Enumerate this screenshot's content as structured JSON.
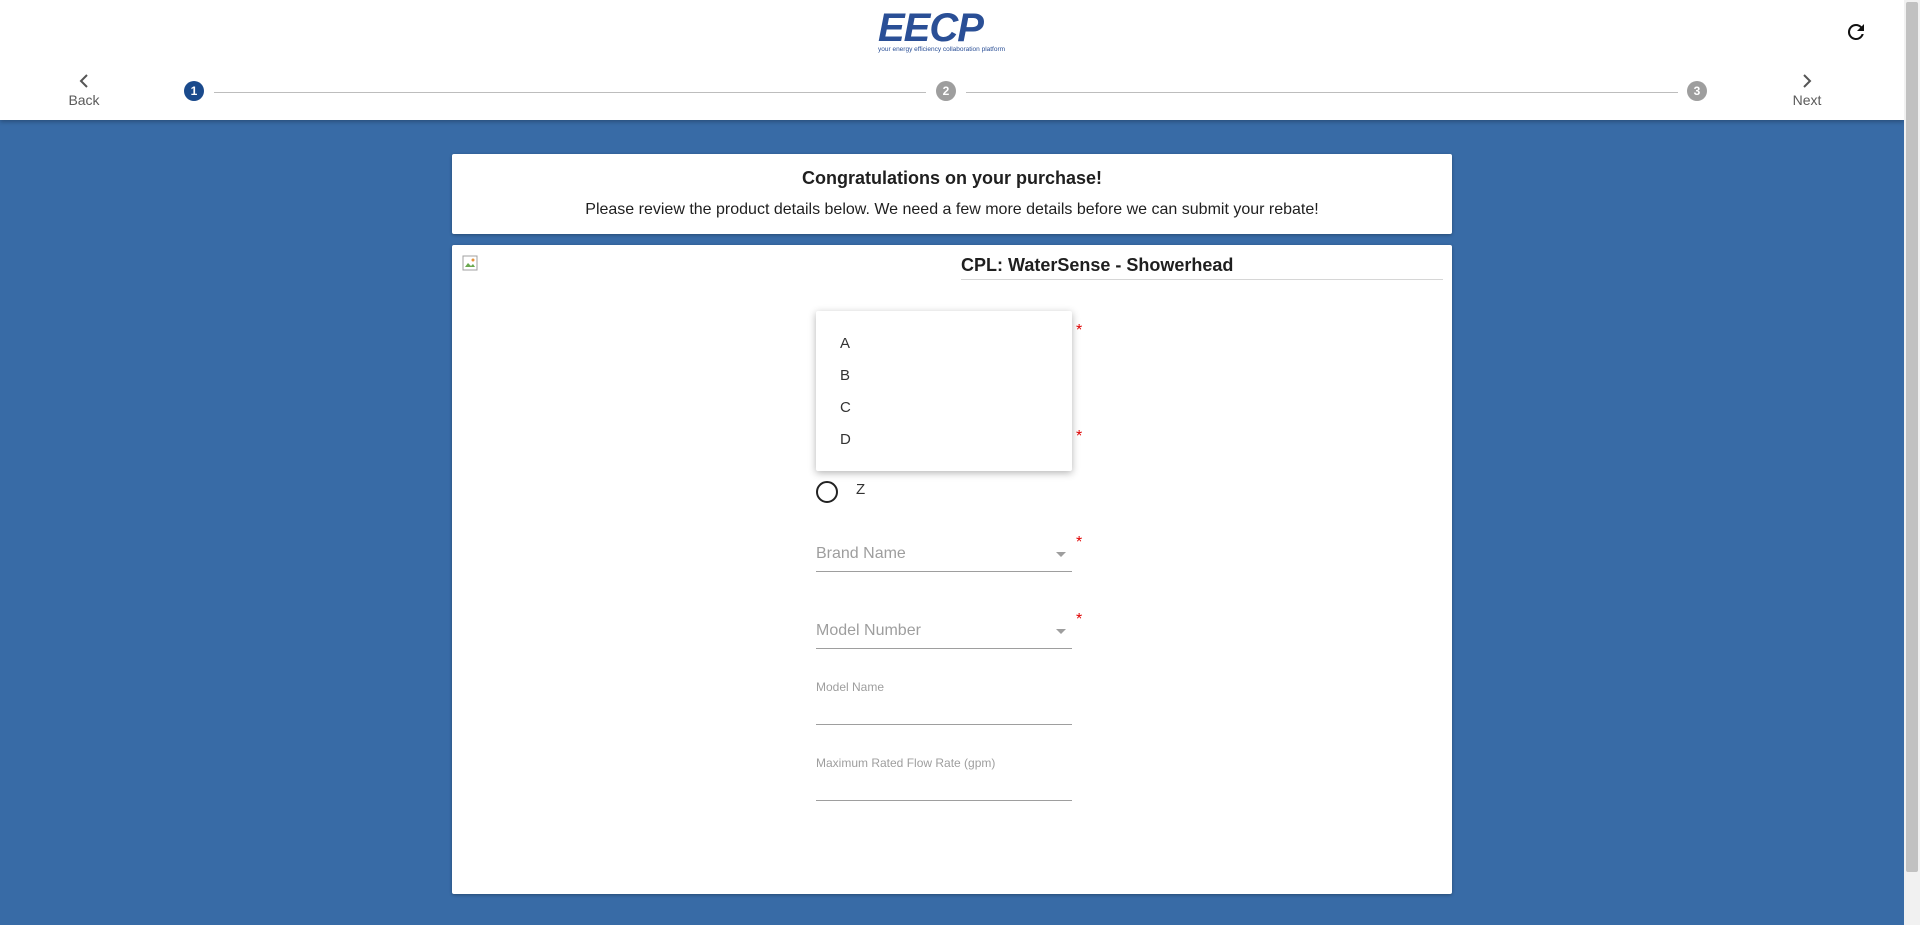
{
  "header": {
    "logo_text": "EECP",
    "logo_tagline": "your energy efficiency collaboration platform",
    "back_label": "Back",
    "next_label": "Next",
    "steps": [
      "1",
      "2",
      "3"
    ],
    "active_step": 1
  },
  "intro": {
    "title": "Congratulations on your purchase!",
    "subtitle": "Please review the product details below. We need a few more details before we can submit your rebate!"
  },
  "product": {
    "title": "CPL: WaterSense - Showerhead"
  },
  "form": {
    "required_mark": "*",
    "radio_option": "Z",
    "brand_placeholder": "Brand Name",
    "model_number_placeholder": "Model Number",
    "model_name_label": "Model Name",
    "flow_rate_label": "Maximum Rated Flow Rate (gpm)"
  },
  "dropdown": {
    "options": [
      "A",
      "B",
      "C",
      "D"
    ]
  },
  "colors": {
    "background": "#386ba6",
    "step_active": "#1a4a8c",
    "step_inactive": "#9e9e9e",
    "required": "#e00000",
    "logo": "#2a4f96"
  }
}
